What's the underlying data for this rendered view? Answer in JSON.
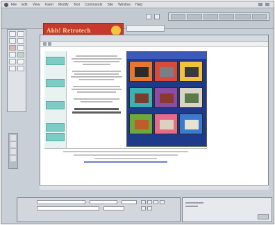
{
  "menubar": {
    "items": [
      "File",
      "Edit",
      "View",
      "Insert",
      "Modify",
      "Text",
      "Commands",
      "Site",
      "Window",
      "Help"
    ]
  },
  "logo": {
    "text": "Ahh! Retrotech",
    "colors": {
      "background": "#c7392c",
      "text": "#f4d9a0",
      "badge": "#f3c53a"
    }
  },
  "image_panel": {
    "tiles": [
      {
        "bg": "#e8772e",
        "obj": "#2b2b2b"
      },
      {
        "bg": "#d94a3a",
        "obj": "#7a7f86"
      },
      {
        "bg": "#f2c23a",
        "obj": "#3a3a3a"
      },
      {
        "bg": "#3bb2b0",
        "obj": "#7c3b2e"
      },
      {
        "bg": "#8d4aa8",
        "obj": "#8a3a2a"
      },
      {
        "bg": "#d8d4c6",
        "obj": "#5b7a4a"
      },
      {
        "bg": "#6aaa3a",
        "obj": "#c05b2a"
      },
      {
        "bg": "#e36c8e",
        "obj": "#d9d3bd"
      },
      {
        "bg": "#3a7bd0",
        "obj": "#e8e2d0"
      }
    ]
  },
  "colors": {
    "accent_teal": "#7ccbc4",
    "panel_blue": "#1e3a8a"
  }
}
